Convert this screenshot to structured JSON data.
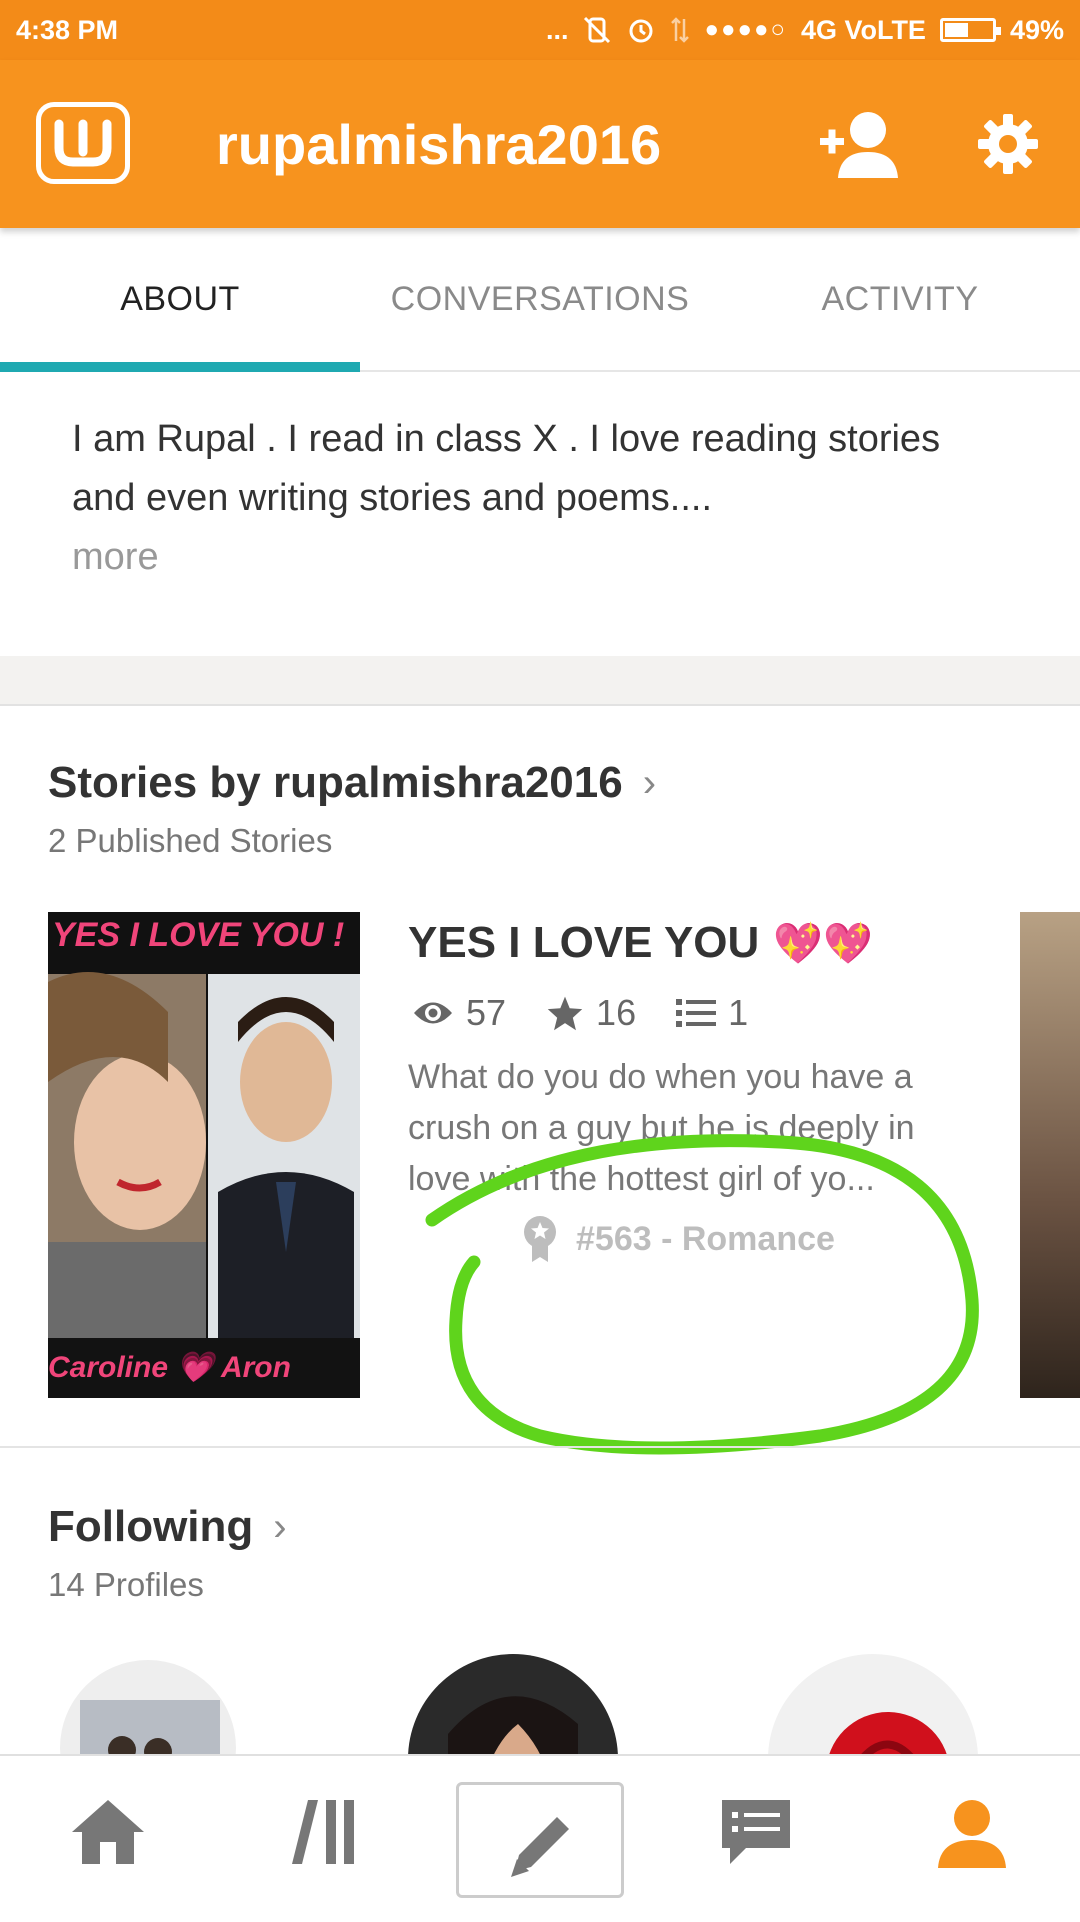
{
  "status_bar": {
    "time": "4:38 PM",
    "dots": "...",
    "signal": "●●●●○",
    "network": "4G VoLTE",
    "battery": "49%",
    "battery_level": 0.49
  },
  "app_bar": {
    "logo_letter": "w",
    "title": "rupalmishra2016",
    "icons": [
      "add-friend-icon",
      "settings-icon"
    ]
  },
  "tabs": [
    {
      "label": "ABOUT",
      "active": true
    },
    {
      "label": "CONVERSATIONS",
      "active": false
    },
    {
      "label": "ACTIVITY",
      "active": false
    }
  ],
  "about": {
    "text": "I am Rupal . I read in class X . I love reading stories and even writing stories and poems....",
    "more": "more"
  },
  "stories_section": {
    "title": "Stories by rupalmishra2016",
    "subtitle": "2 Published Stories",
    "story": {
      "cover_top": "YES I LOVE YOU !",
      "cover_bottom": "Caroline 💗 Aron",
      "title": "YES I LOVE YOU",
      "title_emoji": "💖💖",
      "reads": "57",
      "votes": "16",
      "parts": "1",
      "description": "What do you do when you have a crush on a guy but he is deeply in love with the hottest girl of yo...",
      "rank": "#563 - Romance"
    }
  },
  "following_section": {
    "title": "Following",
    "subtitle": "14 Profiles"
  },
  "bottom_nav": {
    "items": [
      "home-icon",
      "library-icon",
      "write-icon",
      "messages-icon",
      "profile-icon"
    ],
    "active": "profile-icon"
  },
  "colors": {
    "brand_orange": "#f7931e",
    "tab_indicator": "#1fa9b1",
    "annotation_green": "#5fd41c"
  }
}
